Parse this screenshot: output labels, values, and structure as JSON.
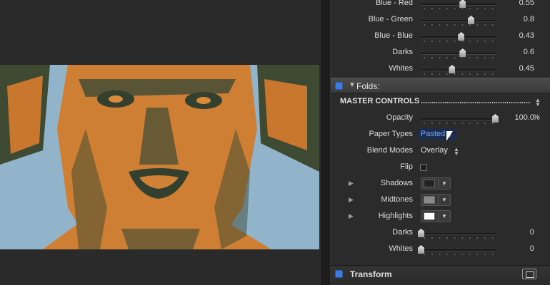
{
  "blue_rows": [
    {
      "label": "Blue - Red",
      "value": "0.55",
      "level": 0.55
    },
    {
      "label": "Blue - Green",
      "value": "0.8",
      "level": 0.66
    },
    {
      "label": "Blue - Blue",
      "value": "0.43",
      "level": 0.53
    },
    {
      "label": "Darks",
      "value": "0.6",
      "level": 0.55
    },
    {
      "label": "Whites",
      "value": "0.45",
      "level": 0.41
    }
  ],
  "folds": {
    "title": "Folds:",
    "master_controls": "MASTER CONTROLS",
    "opacity": {
      "label": "Opacity",
      "value": "100.0",
      "unit": "%",
      "level": 0.98
    },
    "paper_types": {
      "label": "Paper Types",
      "value": "Pasted"
    },
    "blend_modes": {
      "label": "Blend Modes",
      "value": "Overlay"
    },
    "flip": {
      "label": "Flip"
    },
    "shadows": {
      "label": "Shadows",
      "color": "#222222"
    },
    "midtones": {
      "label": "Midtones",
      "color": "#8a8a8a"
    },
    "highlights": {
      "label": "Highlights",
      "color": "#ffffff"
    },
    "darks": {
      "label": "Darks",
      "value": "0",
      "level": 0.0
    },
    "whites": {
      "label": "Whites",
      "value": "0",
      "level": 0.0
    }
  },
  "transform": {
    "title": "Transform"
  },
  "icons": {
    "section_toggle": "blue-checkbox-icon",
    "disclosure": "triangle-icon",
    "transform_tool": "transform-onscreen-icon"
  }
}
